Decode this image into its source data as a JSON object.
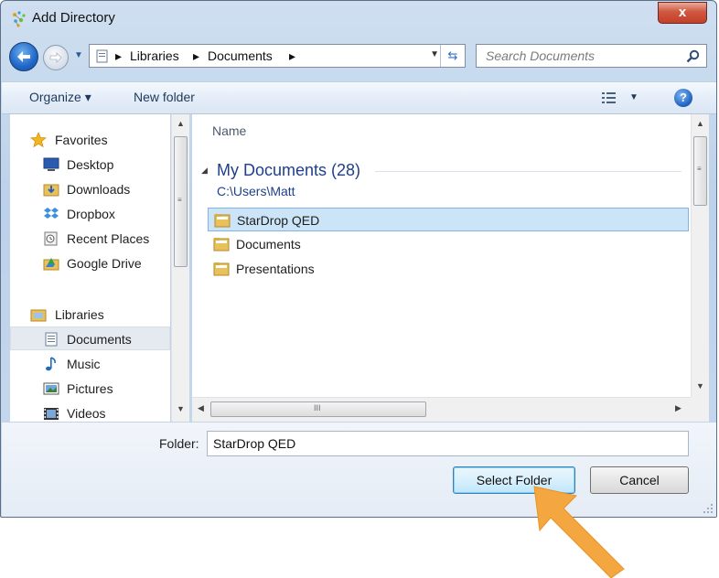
{
  "window": {
    "title": "Add Directory",
    "close_glyph": "x"
  },
  "navigation": {
    "breadcrumbs": [
      "Libraries",
      "Documents"
    ],
    "search_placeholder": "Search Documents"
  },
  "toolbar": {
    "organize_label": "Organize ▾",
    "new_folder_label": "New folder",
    "help_glyph": "?"
  },
  "nav_pane": {
    "favorites_header": "Favorites",
    "favorites": [
      {
        "label": "Desktop",
        "icon": "desktop-icon"
      },
      {
        "label": "Downloads",
        "icon": "downloads-folder-icon"
      },
      {
        "label": "Dropbox",
        "icon": "dropbox-icon"
      },
      {
        "label": "Recent Places",
        "icon": "recent-places-icon"
      },
      {
        "label": "Google Drive",
        "icon": "google-drive-icon"
      }
    ],
    "libraries_header": "Libraries",
    "libraries": [
      {
        "label": "Documents",
        "icon": "documents-library-icon",
        "selected": true
      },
      {
        "label": "Music",
        "icon": "music-icon"
      },
      {
        "label": "Pictures",
        "icon": "pictures-icon"
      },
      {
        "label": "Videos",
        "icon": "videos-icon"
      }
    ]
  },
  "content": {
    "column_header": "Name",
    "group_title": "My Documents (28)",
    "group_path": "C:\\Users\\Matt",
    "items": [
      {
        "label": "StarDrop QED",
        "selected": true
      },
      {
        "label": "Documents",
        "selected": false
      },
      {
        "label": "Presentations",
        "selected": false
      }
    ]
  },
  "bottom": {
    "folder_label": "Folder:",
    "folder_value": "StarDrop QED",
    "select_button": "Select Folder",
    "cancel_button": "Cancel"
  },
  "colors": {
    "accent_arrow": "#f4a640",
    "selection": "#cce4f7",
    "link_blue": "#1e3f8a"
  }
}
